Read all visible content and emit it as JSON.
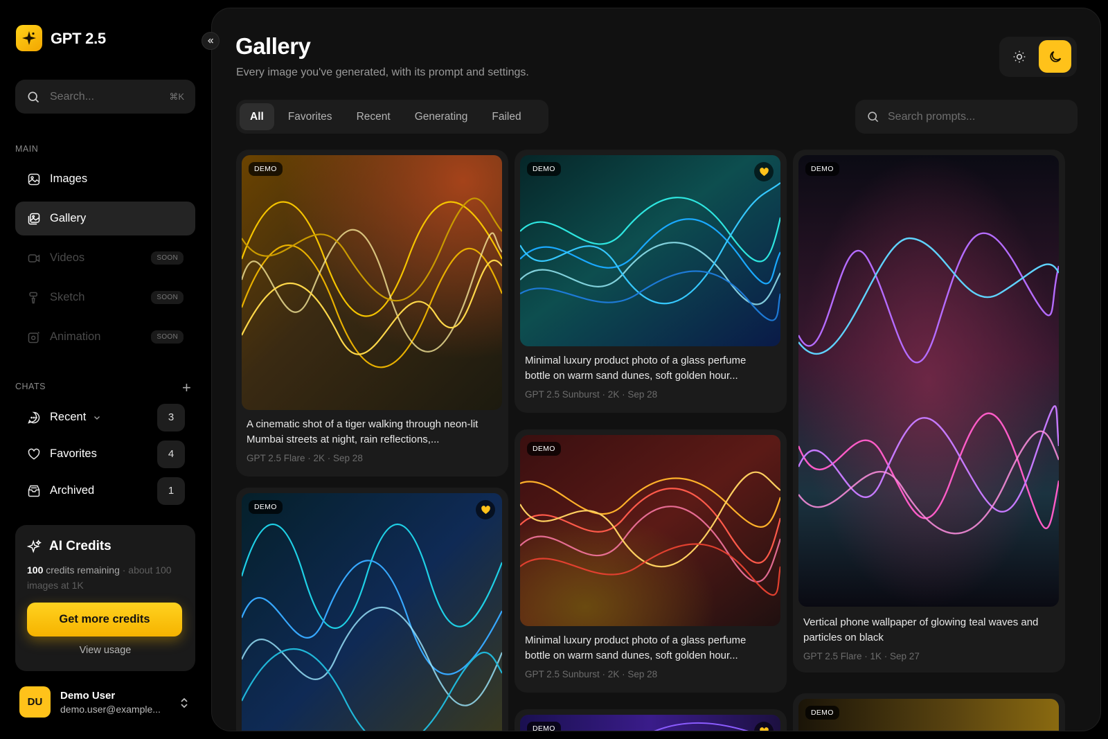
{
  "app": {
    "name": "GPT 2.5"
  },
  "search": {
    "placeholder": "Search...",
    "shortcut": "⌘K"
  },
  "sidebar": {
    "main_label": "MAIN",
    "main_items": [
      {
        "label": "Images",
        "icon": "image-icon",
        "state": "normal"
      },
      {
        "label": "Gallery",
        "icon": "gallery-icon",
        "state": "active"
      },
      {
        "label": "Videos",
        "icon": "video-icon",
        "state": "disabled",
        "badge": "SOON"
      },
      {
        "label": "Sketch",
        "icon": "brush-icon",
        "state": "disabled",
        "badge": "SOON"
      },
      {
        "label": "Animation",
        "icon": "animation-icon",
        "state": "disabled",
        "badge": "SOON"
      }
    ],
    "chats_label": "CHATS",
    "chat_items": [
      {
        "label": "Recent",
        "icon": "chat-icon",
        "count": "3"
      },
      {
        "label": "Favorites",
        "icon": "heart-icon",
        "count": "4"
      },
      {
        "label": "Archived",
        "icon": "archive-icon",
        "count": "1"
      }
    ]
  },
  "credits": {
    "title": "AI Credits",
    "amount": "100",
    "remaining_text": " credits remaining",
    "about_text": " · about 100 images at 1K",
    "cta": "Get more credits",
    "usage_link": "View usage"
  },
  "user": {
    "initials": "DU",
    "name": "Demo User",
    "email": "demo.user@example..."
  },
  "page": {
    "title": "Gallery",
    "subtitle": "Every image you've generated, with its prompt and settings."
  },
  "tabs": [
    "All",
    "Favorites",
    "Recent",
    "Generating",
    "Failed"
  ],
  "active_tab": "All",
  "prompt_search": {
    "placeholder": "Search prompts..."
  },
  "colors": {
    "accent": "#FFC21A",
    "background": "#000000",
    "panel": "#111111",
    "card": "#1B1B1B"
  },
  "cards": [
    {
      "badge": "DEMO",
      "favorite": false,
      "caption": "A cinematic shot of a tiger walking through neon-lit Mumbai streets at night, rain reflections,...",
      "meta": "GPT 2.5 Flare · 2K · Sep 28"
    },
    {
      "badge": "DEMO",
      "favorite": true,
      "caption": "Minimal luxury product photo of a glass perfume bottle on warm sand dunes, soft golden hour...",
      "meta": "GPT 2.5 Sunburst · 2K · Sep 28"
    },
    {
      "badge": "DEMO",
      "favorite": false,
      "caption": "Vertical phone wallpaper of glowing teal waves and particles on black",
      "meta": "GPT 2.5 Flare · 1K · Sep 27"
    },
    {
      "badge": "DEMO",
      "favorite": true
    },
    {
      "badge": "DEMO",
      "favorite": false,
      "caption": "Minimal luxury product photo of a glass perfume bottle on warm sand dunes, soft golden hour...",
      "meta": "GPT 2.5 Sunburst · 2K · Sep 28"
    },
    {
      "badge": "DEMO",
      "favorite": true
    },
    {
      "badge": "DEMO",
      "favorite": false
    }
  ]
}
